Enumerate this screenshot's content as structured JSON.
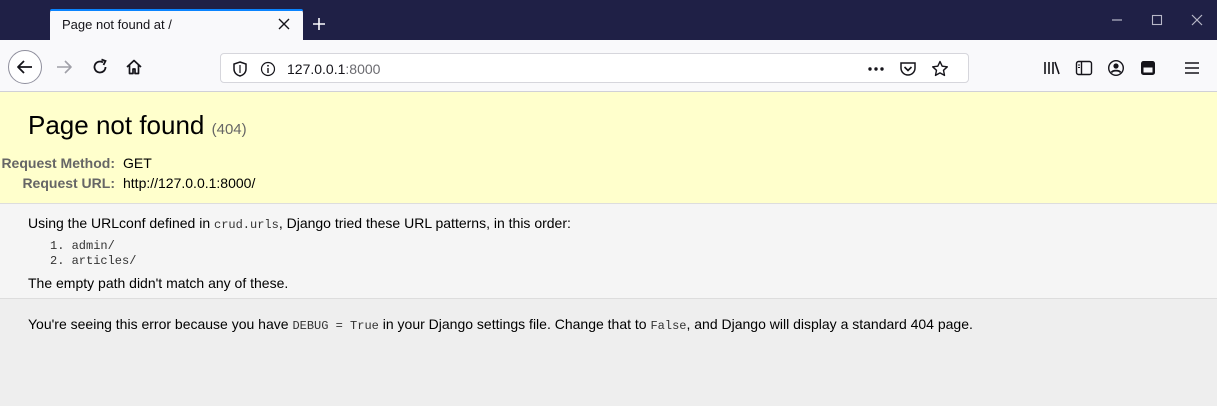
{
  "browser": {
    "tab_title": "Page not found at /",
    "url_host": "127.0.0.1",
    "url_port": ":8000"
  },
  "page": {
    "title": "Page not found",
    "status_code": "(404)",
    "request_method_label": "Request Method:",
    "request_method": "GET",
    "request_url_label": "Request URL:",
    "request_url": "http://127.0.0.1:8000/",
    "urlconf_prefix": "Using the URLconf defined in ",
    "urlconf_module": "crud.urls",
    "urlconf_suffix": ", Django tried these URL patterns, in this order:",
    "patterns": [
      "1. admin/",
      "2. articles/"
    ],
    "no_match": "The empty path didn't match any of these.",
    "debug_prefix": "You're seeing this error because you have ",
    "debug_setting": "DEBUG = True",
    "debug_middle": " in your Django settings file. Change that to ",
    "debug_false": "False",
    "debug_suffix": ", and Django will display a standard 404 page."
  },
  "colors": {
    "summary_bg": "#ffffcc",
    "tabstrip_bg": "#1f2046",
    "tab_accent": "#0a84ff"
  }
}
